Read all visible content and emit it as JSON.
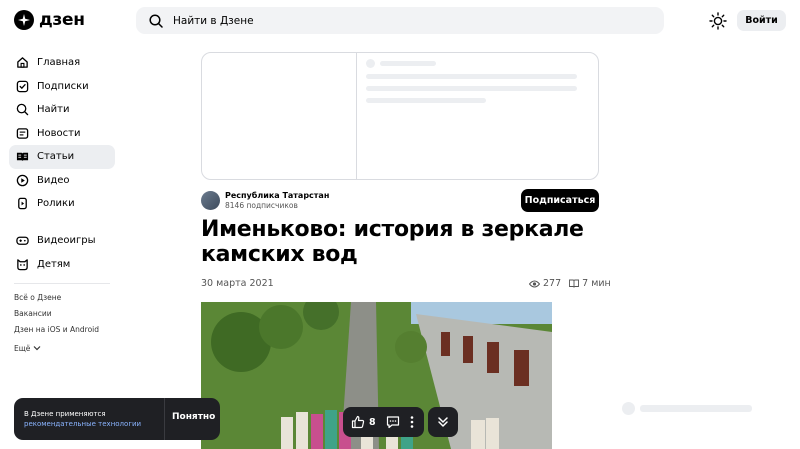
{
  "header": {
    "logo_text": "дзен",
    "search_placeholder": "Найти в Дзене",
    "login_label": "Войти"
  },
  "sidebar": {
    "items": [
      {
        "label": "Главная",
        "icon": "home-icon"
      },
      {
        "label": "Подписки",
        "icon": "subscriptions-icon"
      },
      {
        "label": "Найти",
        "icon": "search-icon"
      },
      {
        "label": "Новости",
        "icon": "news-icon"
      },
      {
        "label": "Статьи",
        "icon": "articles-icon",
        "active": true
      },
      {
        "label": "Видео",
        "icon": "video-icon"
      },
      {
        "label": "Ролики",
        "icon": "shorts-icon"
      }
    ],
    "items2": [
      {
        "label": "Видеоигры",
        "icon": "gamepad-icon"
      },
      {
        "label": "Детям",
        "icon": "kids-icon"
      }
    ],
    "footer_links": [
      "Всё о Дзене",
      "Вакансии",
      "Дзен на iOS и Android"
    ],
    "more_label": "Ещё"
  },
  "article": {
    "channel_name": "Республика Татарстан",
    "channel_subscribers": "8146 подписчиков",
    "subscribe_label": "Подписаться",
    "title": "Именьково: история в зеркале камских вод",
    "date": "30 марта 2021",
    "views": "277",
    "read_time": "7 мин"
  },
  "cookie_banner": {
    "text": "В Дзене применяются",
    "link": "рекомендательные технологии",
    "ok_label": "Понятно"
  },
  "action_bar": {
    "likes": "8"
  }
}
